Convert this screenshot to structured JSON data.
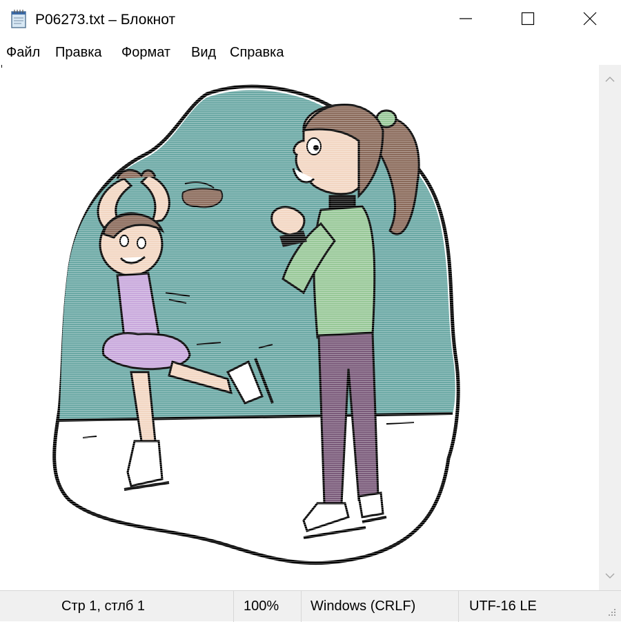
{
  "window": {
    "title": "P06273.txt – Блокнот",
    "icon": "notepad-icon",
    "controls": [
      "minimize-icon",
      "maximize-icon",
      "close-icon"
    ]
  },
  "menu": {
    "items": [
      {
        "label": "Файл"
      },
      {
        "label": "Правка"
      },
      {
        "label": "Формат"
      },
      {
        "label": "Вид"
      },
      {
        "label": "Справка"
      }
    ]
  },
  "status": {
    "position": "Стр 1, стлб 1",
    "zoom": "100%",
    "line_endings": "Windows (CRLF)",
    "encoding": "UTF-16 LE"
  },
  "colors": {
    "ice_wall": "#6aa8a4",
    "girl_dress": "#c8a8dc",
    "teacher_sweater": "#98c898",
    "teacher_pants": "#7a5a7a",
    "hair": "#8a6a5a",
    "skin": "#f2d6c2"
  }
}
